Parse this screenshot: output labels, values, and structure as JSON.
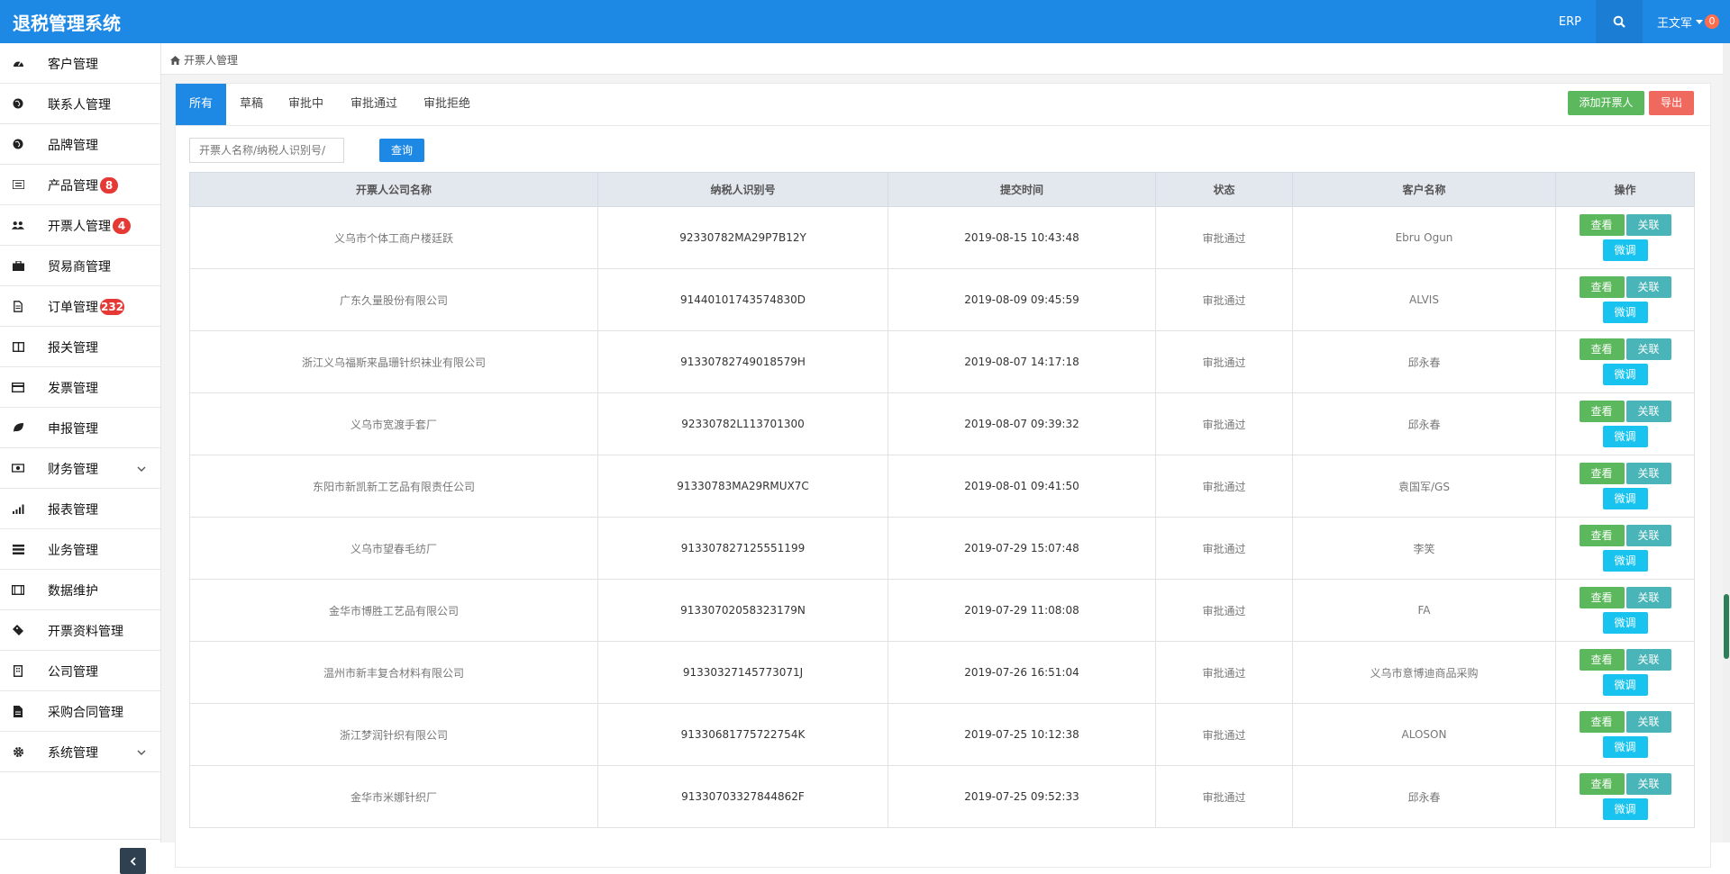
{
  "app": {
    "title": "退税管理系统"
  },
  "topbar": {
    "erp": "ERP",
    "user": "王文军",
    "notification_count": "0"
  },
  "sidebar": {
    "items": [
      {
        "label": "客户管理",
        "icon": "dashboard-icon"
      },
      {
        "label": "联系人管理",
        "icon": "globe-icon"
      },
      {
        "label": "品牌管理",
        "icon": "globe-icon"
      },
      {
        "label": "产品管理",
        "icon": "list-icon",
        "badge": "8"
      },
      {
        "label": "开票人管理",
        "icon": "users-icon",
        "badge": "4"
      },
      {
        "label": "贸易商管理",
        "icon": "briefcase-icon"
      },
      {
        "label": "订单管理",
        "icon": "file-icon",
        "badge": "232"
      },
      {
        "label": "报关管理",
        "icon": "columns-icon"
      },
      {
        "label": "发票管理",
        "icon": "credit-card-icon"
      },
      {
        "label": "申报管理",
        "icon": "leaf-icon"
      },
      {
        "label": "财务管理",
        "icon": "money-icon",
        "has_submenu": true
      },
      {
        "label": "报表管理",
        "icon": "signal-icon"
      },
      {
        "label": "业务管理",
        "icon": "tasks-icon"
      },
      {
        "label": "数据维护",
        "icon": "film-icon"
      },
      {
        "label": "开票资料管理",
        "icon": "ticket-icon"
      },
      {
        "label": "公司管理",
        "icon": "building-icon"
      },
      {
        "label": "采购合同管理",
        "icon": "file-text-icon"
      },
      {
        "label": "系统管理",
        "icon": "gear-icon",
        "has_submenu": true
      }
    ]
  },
  "breadcrumb": {
    "label": "开票人管理"
  },
  "tabs": [
    "所有",
    "草稿",
    "审批中",
    "审批通过",
    "审批拒绝"
  ],
  "actions": {
    "add": "添加开票人",
    "export": "导出"
  },
  "search": {
    "placeholder": "开票人名称/纳税人识别号/",
    "button": "查询"
  },
  "table": {
    "headers": [
      "开票人公司名称",
      "纳税人识别号",
      "提交时间",
      "状态",
      "客户名称",
      "操作"
    ],
    "row_actions": {
      "view": "查看",
      "link": "关联",
      "adjust": "微调"
    },
    "rows": [
      [
        "义乌市个体工商户楼廷跃",
        "92330782MA29P7B12Y",
        "2019-08-15 10:43:48",
        "审批通过",
        "Ebru Ogun"
      ],
      [
        "广东久量股份有限公司",
        "91440101743574830D",
        "2019-08-09 09:45:59",
        "审批通过",
        "ALVIS"
      ],
      [
        "浙江义乌福斯来晶珊针织袜业有限公司",
        "91330782749018579H",
        "2019-08-07 14:17:18",
        "审批通过",
        "邱永春"
      ],
      [
        "义乌市宽渡手套厂",
        "92330782L113701300",
        "2019-08-07 09:39:32",
        "审批通过",
        "邱永春"
      ],
      [
        "东阳市新凯新工艺品有限责任公司",
        "91330783MA29RMUX7C",
        "2019-08-01 09:41:50",
        "审批通过",
        "袁国军/GS"
      ],
      [
        "义乌市望春毛纺厂",
        "913307827125551199",
        "2019-07-29 15:07:48",
        "审批通过",
        "李笑"
      ],
      [
        "金华市博胜工艺品有限公司",
        "91330702058323179N",
        "2019-07-29 11:08:08",
        "审批通过",
        "FA"
      ],
      [
        "温州市新丰复合材料有限公司",
        "91330327145773071J",
        "2019-07-26 16:51:04",
        "审批通过",
        "义乌市意博迪商品采购"
      ],
      [
        "浙江梦润针织有限公司",
        "91330681775722754K",
        "2019-07-25 10:12:38",
        "审批通过",
        "ALOSON"
      ],
      [
        "金华市米娜针织厂",
        "91330703327844862F",
        "2019-07-25 09:52:33",
        "审批通过",
        "邱永春"
      ]
    ]
  }
}
